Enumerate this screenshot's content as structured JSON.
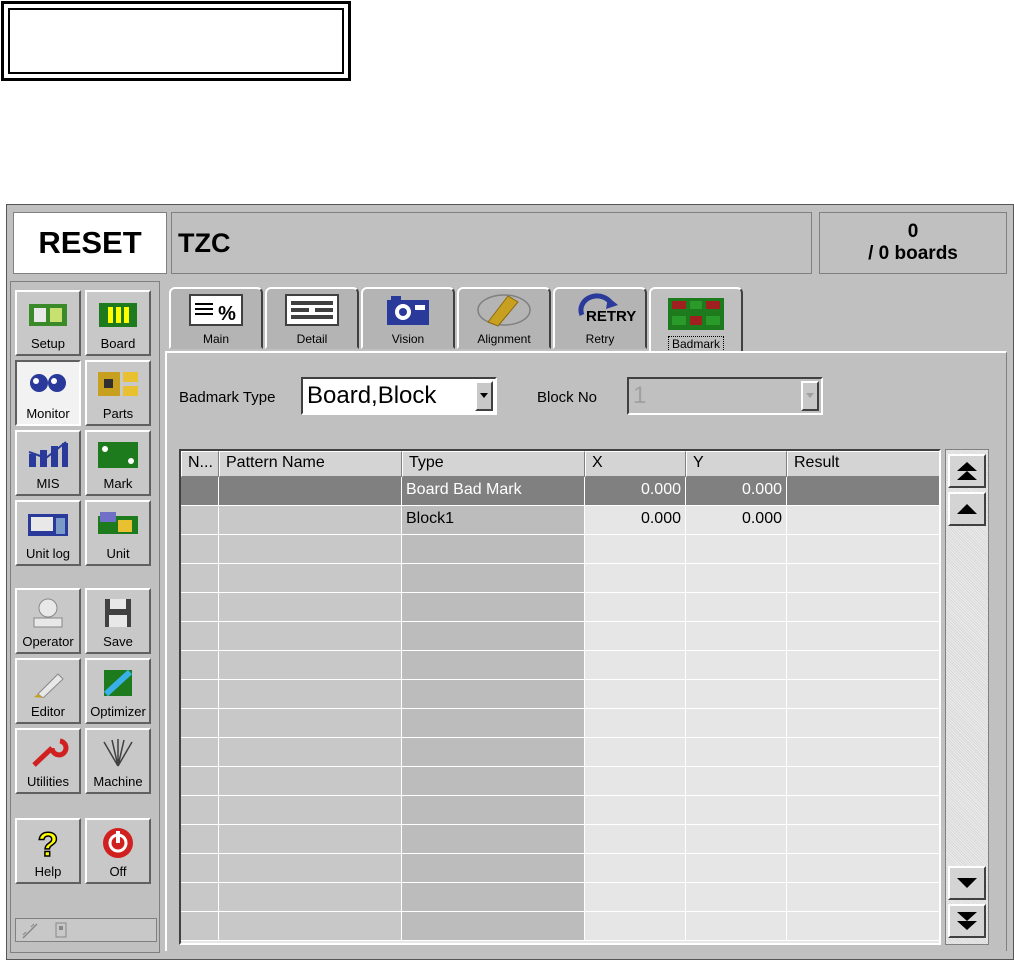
{
  "header": {
    "status": "RESET",
    "title": "TZC",
    "count": "0",
    "count_total": "/ 0 boards"
  },
  "sidebar": {
    "buttons": [
      {
        "label": "Setup",
        "icon": "setup-icon"
      },
      {
        "label": "Board",
        "icon": "board-icon"
      },
      {
        "label": "Monitor",
        "icon": "monitor-icon",
        "active": true
      },
      {
        "label": "Parts",
        "icon": "parts-icon"
      },
      {
        "label": "MIS",
        "icon": "mis-icon"
      },
      {
        "label": "Mark",
        "icon": "mark-icon"
      },
      {
        "label": "Unit log",
        "icon": "unit-log-icon"
      },
      {
        "label": "Unit",
        "icon": "unit-icon"
      },
      {
        "label": "Operator",
        "icon": "operator-icon"
      },
      {
        "label": "Save",
        "icon": "save-icon"
      },
      {
        "label": "Editor",
        "icon": "editor-icon"
      },
      {
        "label": "Optimizer",
        "icon": "optimizer-icon"
      },
      {
        "label": "Utilities",
        "icon": "utilities-icon"
      },
      {
        "label": "Machine",
        "icon": "machine-icon"
      },
      {
        "label": "Help",
        "icon": "help-icon"
      },
      {
        "label": "Off",
        "icon": "power-icon"
      }
    ]
  },
  "tabs": [
    {
      "label": "Main",
      "icon": "main-icon"
    },
    {
      "label": "Detail",
      "icon": "detail-icon"
    },
    {
      "label": "Vision",
      "icon": "camera-icon"
    },
    {
      "label": "Alignment",
      "icon": "alignment-icon"
    },
    {
      "label": "Retry",
      "icon": "retry-icon",
      "icon_text": "RETRY"
    },
    {
      "label": "Badmark",
      "icon": "badmark-icon",
      "active": true
    }
  ],
  "form": {
    "badmark_type_label": "Badmark Type",
    "badmark_type_value": "Board,Block",
    "block_no_label": "Block No",
    "block_no_value": "1"
  },
  "table": {
    "columns": [
      "N...",
      "Pattern Name",
      "Type",
      "X",
      "Y",
      "Result"
    ],
    "rows": [
      {
        "no": "",
        "pattern": "",
        "type": "Board Bad Mark",
        "x": "0.000",
        "y": "0.000",
        "result": "",
        "selected": true
      },
      {
        "no": "",
        "pattern": "",
        "type": "Block1",
        "x": "0.000",
        "y": "0.000",
        "result": ""
      }
    ]
  },
  "colors": {
    "window_bg": "#c0c0c0",
    "selected_row": "#808080",
    "type_column": "#bcbcbc"
  }
}
